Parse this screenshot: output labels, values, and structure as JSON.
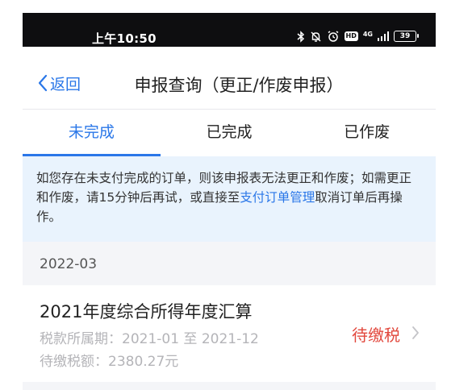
{
  "status_bar": {
    "time": "上午10:50",
    "network": "4G",
    "hd": "HD",
    "battery": "39"
  },
  "nav": {
    "back_label": "返回",
    "title": "申报查询（更正/作废申报）"
  },
  "tabs": [
    {
      "label": "未完成",
      "active": true
    },
    {
      "label": "已完成",
      "active": false
    },
    {
      "label": "已作废",
      "active": false
    }
  ],
  "notice": {
    "text_before": "如您存在未支付完成的订单，则该申报表无法更正和作废；如需更正和作废，请15分钟后再试，或直接至",
    "link": "支付订单管理",
    "text_after": "取消订单后再操作。"
  },
  "records_group": {
    "month": "2022-03",
    "items": [
      {
        "title": "2021年度综合所得年度汇算",
        "period": "税款所属期：2021-01 至 2021-12",
        "amount": "待缴税额：2380.27元",
        "status": "待缴税"
      }
    ]
  },
  "colors": {
    "accent": "#2a77e8",
    "status_pending": "#e2483d",
    "notice_bg": "#e9f3fd"
  }
}
